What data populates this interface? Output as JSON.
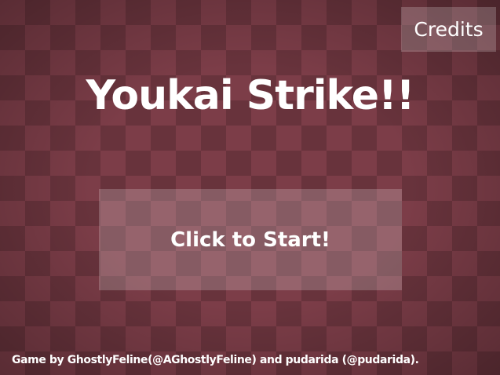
{
  "title_screen": {
    "credits_label": "Credits",
    "title": "Youkai Strike!!",
    "start_label": "Click to Start!",
    "footer_credit": "Game by GhostlyFeline(@AGhostlyFeline) and pudarida (@pudarida)."
  },
  "colors": {
    "background": "#7c3d48",
    "text": "#ffffff",
    "button_overlay": "rgba(255,255,255,0.20)"
  }
}
